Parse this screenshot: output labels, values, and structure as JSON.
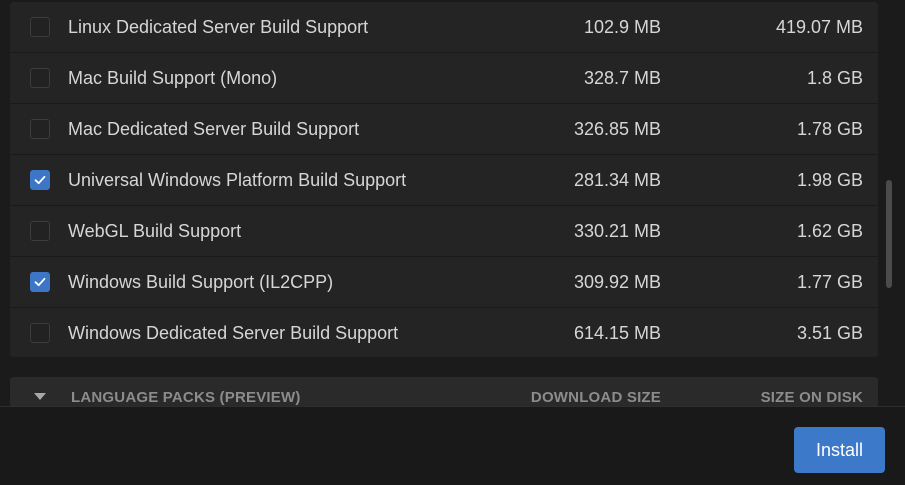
{
  "modules": [
    {
      "name": "Linux Dedicated Server Build Support",
      "download": "102.9 MB",
      "disk": "419.07 MB",
      "checked": false
    },
    {
      "name": "Mac Build Support (Mono)",
      "download": "328.7 MB",
      "disk": "1.8 GB",
      "checked": false
    },
    {
      "name": "Mac Dedicated Server Build Support",
      "download": "326.85 MB",
      "disk": "1.78 GB",
      "checked": false
    },
    {
      "name": "Universal Windows Platform Build Support",
      "download": "281.34 MB",
      "disk": "1.98 GB",
      "checked": true
    },
    {
      "name": "WebGL Build Support",
      "download": "330.21 MB",
      "disk": "1.62 GB",
      "checked": false
    },
    {
      "name": "Windows Build Support (IL2CPP)",
      "download": "309.92 MB",
      "disk": "1.77 GB",
      "checked": true
    },
    {
      "name": "Windows Dedicated Server Build Support",
      "download": "614.15 MB",
      "disk": "3.51 GB",
      "checked": false
    }
  ],
  "language_section": {
    "title": "LANGUAGE PACKS (PREVIEW)",
    "download_header": "DOWNLOAD SIZE",
    "disk_header": "SIZE ON DISK"
  },
  "footer": {
    "install_label": "Install"
  },
  "colors": {
    "accent": "#3d79c9",
    "checkbox_checked": "#3d76c6"
  }
}
